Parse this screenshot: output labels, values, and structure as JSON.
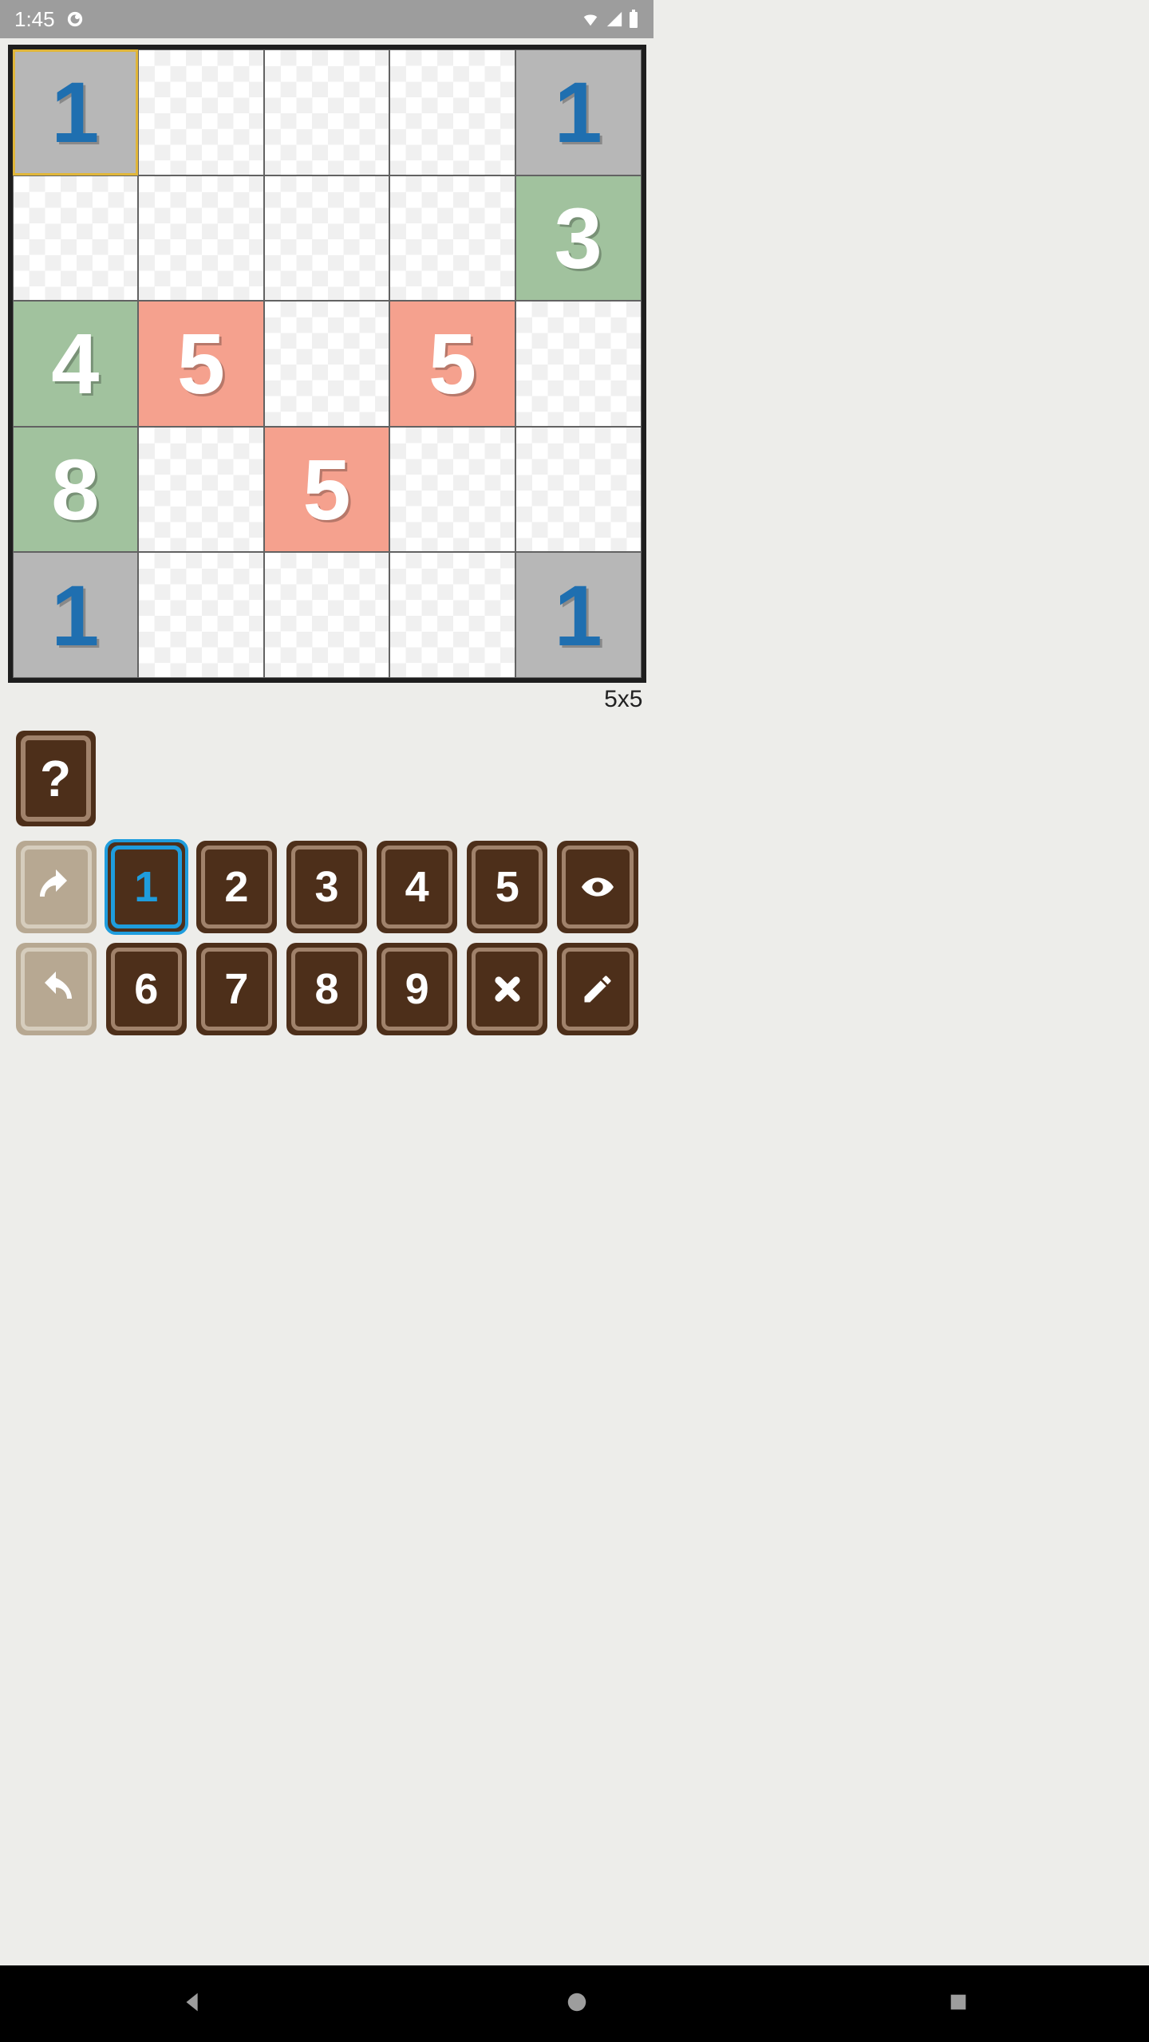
{
  "statusbar": {
    "time": "1:45"
  },
  "board": {
    "caption": "5x5",
    "cells": [
      {
        "r": 0,
        "c": 0,
        "v": "1",
        "fill": "gray",
        "txt": "blue",
        "selected": true
      },
      {
        "r": 0,
        "c": 4,
        "v": "1",
        "fill": "gray",
        "txt": "blue"
      },
      {
        "r": 1,
        "c": 4,
        "v": "3",
        "fill": "green",
        "txt": "white"
      },
      {
        "r": 2,
        "c": 0,
        "v": "4",
        "fill": "green",
        "txt": "white"
      },
      {
        "r": 2,
        "c": 1,
        "v": "5",
        "fill": "salmon",
        "txt": "white"
      },
      {
        "r": 2,
        "c": 3,
        "v": "5",
        "fill": "salmon",
        "txt": "white"
      },
      {
        "r": 3,
        "c": 0,
        "v": "8",
        "fill": "green",
        "txt": "white"
      },
      {
        "r": 3,
        "c": 2,
        "v": "5",
        "fill": "salmon",
        "txt": "white"
      },
      {
        "r": 4,
        "c": 0,
        "v": "1",
        "fill": "gray",
        "txt": "blue"
      },
      {
        "r": 4,
        "c": 4,
        "v": "1",
        "fill": "gray",
        "txt": "blue"
      }
    ]
  },
  "controls": {
    "help": "?",
    "nums": [
      "1",
      "2",
      "3",
      "4",
      "5",
      "6",
      "7",
      "8",
      "9"
    ],
    "active_num": "1"
  }
}
